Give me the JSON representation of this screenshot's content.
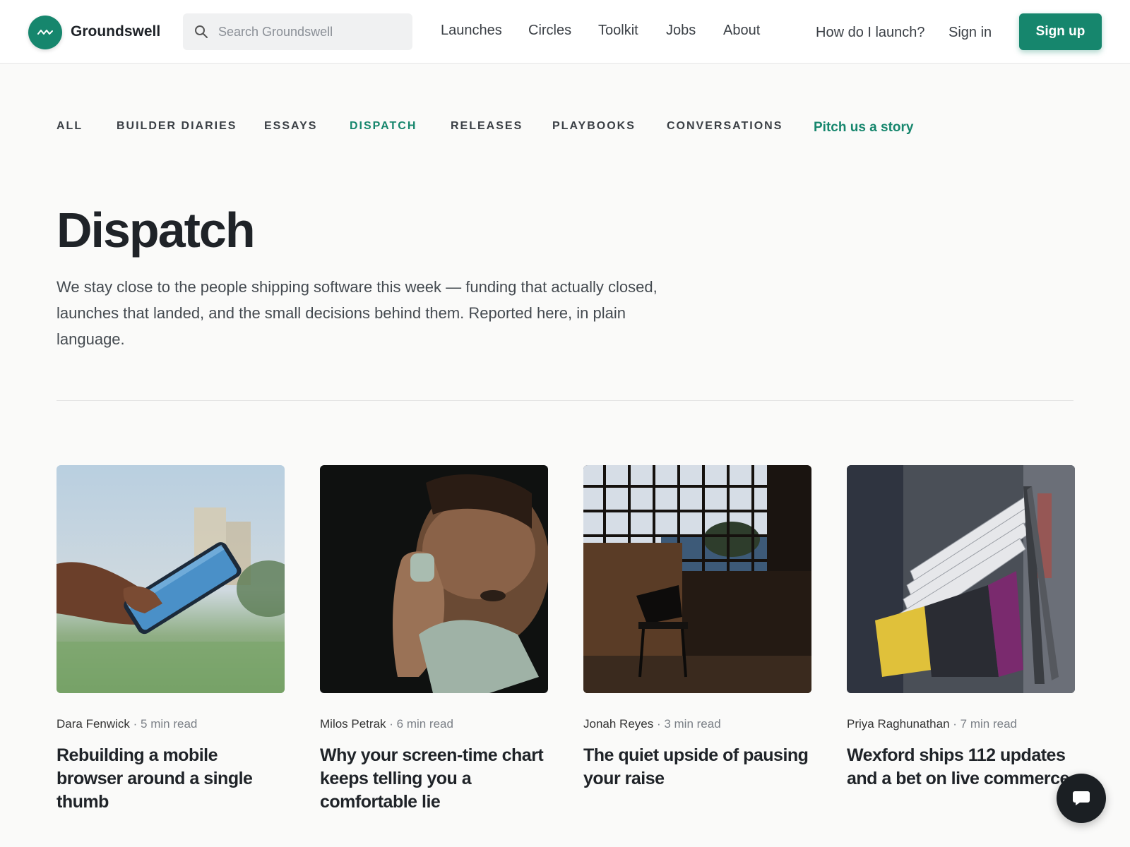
{
  "header": {
    "brand": "Groundswell",
    "search_placeholder": "Search Groundswell",
    "nav": [
      "Launches",
      "Circles",
      "Toolkit",
      "Jobs",
      "About"
    ],
    "help_link": "How do I launch?",
    "sign_in": "Sign in",
    "sign_up": "Sign up",
    "icons": {
      "logo": "wave-logo-icon",
      "search": "search-icon"
    }
  },
  "tabs": {
    "items": [
      "ALL",
      "BUILDER DIARIES",
      "ESSAYS",
      "DISPATCH",
      "RELEASES",
      "PLAYBOOKS",
      "CONVERSATIONS"
    ],
    "active": "DISPATCH",
    "pitch": "Pitch us a story"
  },
  "page": {
    "title": "Dispatch",
    "intro": "We stay close to the people shipping software this week — funding that actually closed, launches that landed, and the small decisions behind them. Reported here, in plain language."
  },
  "articles": [
    {
      "author": "Dara Fenwick",
      "read_time": "5 min read",
      "title": "Rebuilding a mobile browser around a single thumb",
      "image": "hand holding a smartphone outdoors"
    },
    {
      "author": "Milos Petrak",
      "read_time": "6 min read",
      "title": "Why your screen-time chart keeps telling you a comfortable lie",
      "image": "man holding a telephone receiver in the dark"
    },
    {
      "author": "Jonah Reyes",
      "read_time": "3 min read",
      "title": "The quiet upside of pausing your raise",
      "image": "empty chair in a dim room by a window"
    },
    {
      "author": "Priya Raghunathan",
      "read_time": "7 min read",
      "title": "Wexford ships 112 updates and a bet on live commerce",
      "image": "clothing rack with hangers in a shop"
    }
  ],
  "colors": {
    "accent": "#16866d",
    "text": "#1f2328",
    "background": "#fafaf9"
  },
  "chat_icon": "chat-bubble-icon"
}
